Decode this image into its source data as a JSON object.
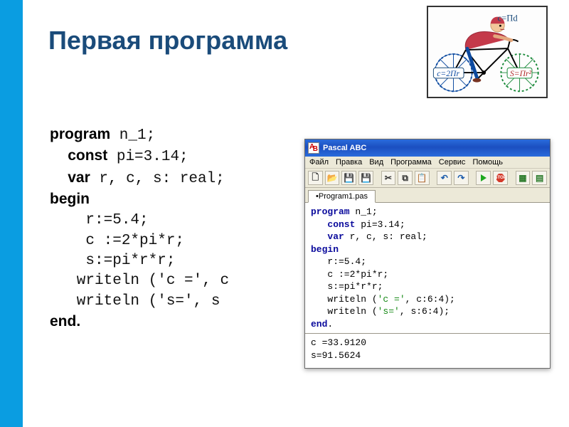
{
  "title": "Первая программа",
  "code": {
    "l1": {
      "kw": "program",
      "rest": " n_1;"
    },
    "l2": {
      "indent": "  ",
      "kw": "const",
      "rest": " pi=3.14;"
    },
    "l3": {
      "indent": "  ",
      "kw": "var",
      "rest": " r, c, s: real;"
    },
    "l4": {
      "kw": "begin"
    },
    "l5": "    r:=5.4;",
    "l6": "    c :=2*pi*r;",
    "l7": "    s:=pi*r*r;",
    "l8": "   writeln ('c =', c:6:4);",
    "l8v": "   writeln ('c =', c",
    "l9": "   writeln ('s=', s:6:4);",
    "l9v": "   writeln ('s=', s",
    "l10": {
      "kw": "end."
    }
  },
  "art": {
    "cPd": "c=Пd",
    "c2Pr": "c=2Пr",
    "sPr2": "S=Пr²"
  },
  "pascal": {
    "windowTitle": "Pascal ABC",
    "menu": [
      "Файл",
      "Правка",
      "Вид",
      "Программа",
      "Сервис",
      "Помощь"
    ],
    "tab": "•Program1.pas",
    "toolbar_icons": {
      "new": "new-file-icon",
      "open": "open-folder-icon",
      "save": "save-icon",
      "saveall": "save-all-icon",
      "cut": "cut-icon",
      "copy": "copy-icon",
      "paste": "paste-icon",
      "undo": "undo-icon",
      "redo": "redo-icon",
      "run": "run-icon",
      "stop": "stop-icon",
      "b1": "module-icon",
      "b2": "form-icon"
    },
    "editor": [
      {
        "kw": "program",
        "rest": " n_1;"
      },
      {
        "indent": "   ",
        "kw": "const",
        "rest": " pi=3.14;"
      },
      {
        "indent": "   ",
        "kw": "var",
        "rest": " r, c, s: real;"
      },
      {
        "kw": "begin"
      },
      {
        "plain": "   r:=5.4;"
      },
      {
        "plain": "   c :=2*pi*r;"
      },
      {
        "plain": "   s:=pi*r*r;"
      },
      {
        "plain": "   writeln (",
        "str": "'c ='",
        "rest2": ", c:6:4);"
      },
      {
        "plain": "   writeln (",
        "str": "'s='",
        "rest2": ", s:6:4);"
      },
      {
        "kw": "end",
        "rest": "."
      }
    ],
    "output": [
      "c =33.9120",
      "s=91.5624"
    ]
  }
}
